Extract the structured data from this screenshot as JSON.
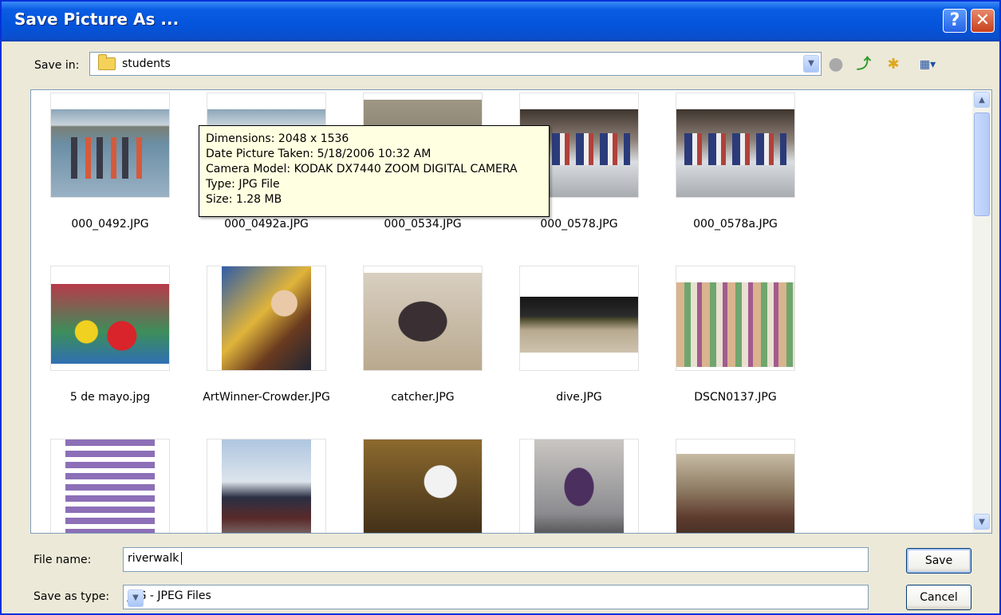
{
  "window": {
    "title": "Save Picture As ...",
    "help_label": "?",
    "close_label": "✕"
  },
  "toolbar": {
    "save_in_label": "Save in:",
    "save_in_value": "students",
    "icons": [
      "folder-icon",
      "back-icon",
      "up-folder-icon",
      "new-folder-icon",
      "views-menu-icon"
    ]
  },
  "files": [
    {
      "name": "000_0492.JPG"
    },
    {
      "name": "000_0492a.JPG"
    },
    {
      "name": "000_0534.JPG"
    },
    {
      "name": "000_0578.JPG"
    },
    {
      "name": "000_0578a.JPG"
    },
    {
      "name": "5 de mayo.jpg"
    },
    {
      "name": "ArtWinner-Crowder.JPG"
    },
    {
      "name": "catcher.JPG"
    },
    {
      "name": "dive.JPG"
    },
    {
      "name": "DSCN0137.JPG"
    },
    {
      "name": ""
    },
    {
      "name": ""
    },
    {
      "name": ""
    },
    {
      "name": ""
    },
    {
      "name": ""
    }
  ],
  "tooltip": {
    "dimensions": "Dimensions: 2048 x 1536",
    "date_taken": "Date Picture Taken: 5/18/2006 10:32 AM",
    "camera": "Camera Model: KODAK DX7440 ZOOM DIGITAL CAMERA",
    "type": "Type: JPG File",
    "size": "Size: 1.28 MB"
  },
  "footer": {
    "file_name_label": "File name:",
    "file_name_value": "riverwalk",
    "save_type_label": "Save as type:",
    "save_type_value": "JPG - JPEG Files",
    "save_button": "Save",
    "cancel_button": "Cancel"
  },
  "colors": {
    "title_bar": "#0454DB",
    "dialog_bg": "#ECE9D8",
    "tooltip_bg": "#FFFFE1"
  }
}
